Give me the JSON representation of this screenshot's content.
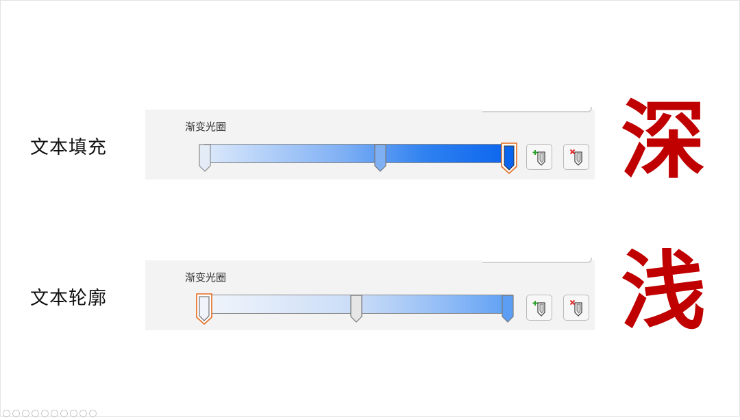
{
  "rows": [
    {
      "label": "文本填充",
      "panel_title": "渐变光圈",
      "gradient_stops": [
        0.0,
        0.5,
        1.0
      ],
      "selected_stop": 2,
      "emphasis": "深"
    },
    {
      "label": "文本轮廓",
      "panel_title": "渐变光圈",
      "gradient_stops": [
        0.0,
        0.5,
        1.0
      ],
      "selected_stop": 0,
      "emphasis": "浅"
    }
  ],
  "buttons": {
    "add_stop_icon": "add-gradient-stop-icon",
    "remove_stop_icon": "remove-gradient-stop-icon"
  },
  "colors": {
    "emphasis": "#c00000",
    "selected_stop_outline": "#e46a1c",
    "dark_gradient_end": "#0a64ee",
    "light_gradient_end": "#5c9ef4"
  }
}
